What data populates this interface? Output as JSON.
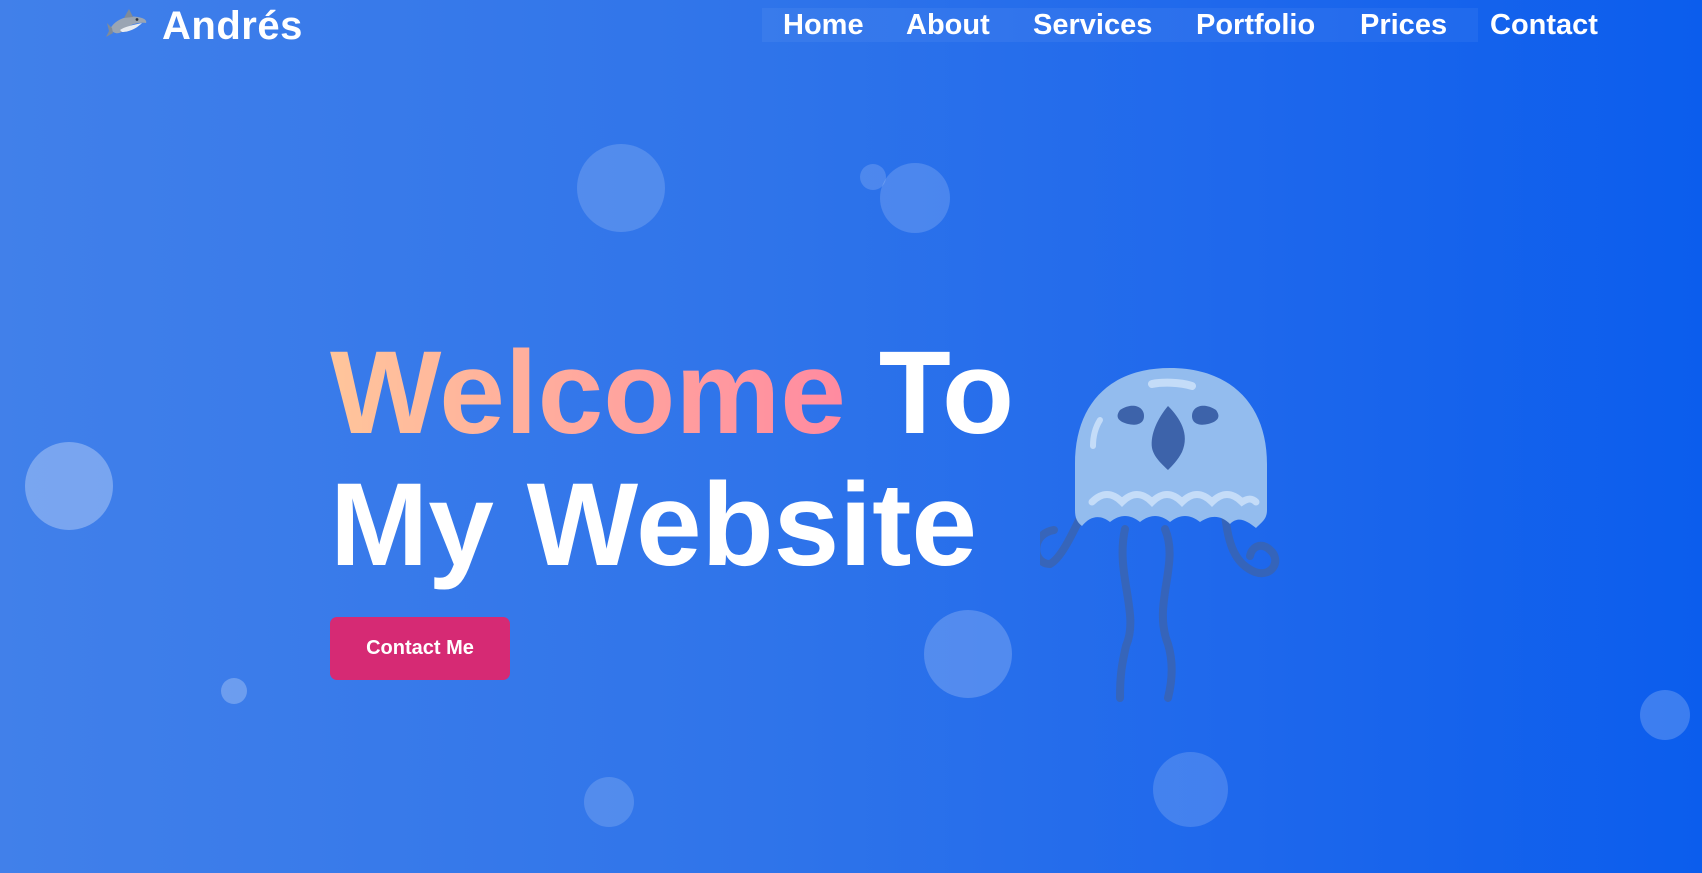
{
  "brand": {
    "name": "Andrés",
    "icon": "shark-icon"
  },
  "nav": {
    "items": [
      {
        "label": "Home"
      },
      {
        "label": "About"
      },
      {
        "label": "Services"
      },
      {
        "label": "Portfolio"
      },
      {
        "label": "Prices"
      },
      {
        "label": "Contact"
      }
    ]
  },
  "hero": {
    "highlight": "Welcome",
    "title_rest_line1": "To",
    "title_line2": "My Website",
    "cta_label": "Contact Me",
    "illustration": "jellyfish-icon"
  },
  "colors": {
    "background_start": "#4180ea",
    "background_end": "#0b5ded",
    "highlight_start": "#ffc59b",
    "highlight_end": "#ff8aa0",
    "cta": "#d62a74",
    "jellyfish_bell": "#93bcee",
    "jellyfish_tentacle": "#3d63aa"
  }
}
